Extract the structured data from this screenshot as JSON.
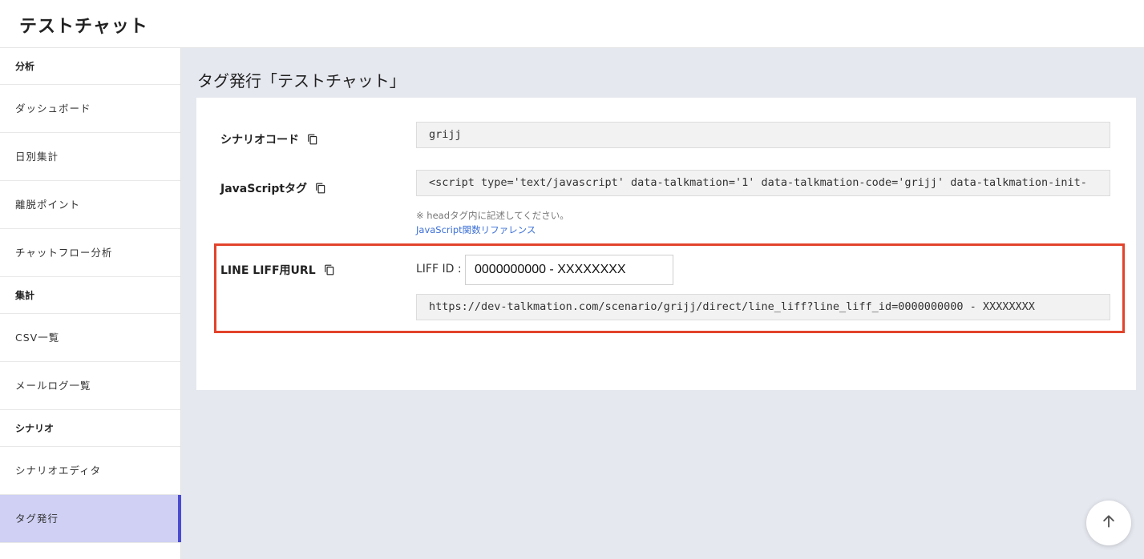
{
  "app": {
    "title": "テストチャット"
  },
  "sidebar": {
    "sections": [
      {
        "header": "分析",
        "items": [
          {
            "label": "ダッシュボード"
          },
          {
            "label": "日別集計"
          },
          {
            "label": "離脱ポイント"
          },
          {
            "label": "チャットフロー分析"
          }
        ]
      },
      {
        "header": "集計",
        "items": [
          {
            "label": "CSV一覧"
          },
          {
            "label": "メールログ一覧"
          }
        ]
      },
      {
        "header": "シナリオ",
        "items": [
          {
            "label": "シナリオエディタ"
          },
          {
            "label": "タグ発行",
            "active": true
          }
        ]
      }
    ]
  },
  "main": {
    "page_title": "タグ発行「テストチャット」",
    "scenario_code": {
      "label": "シナリオコード",
      "value": "grijj"
    },
    "js_tag": {
      "label": "JavaScriptタグ",
      "value": "<script type='text/javascript' data-talkmation='1' data-talkmation-code='grijj' data-talkmation-init-",
      "note": "※ headタグ内に記述してください。",
      "link": "JavaScript関数リファレンス"
    },
    "liff": {
      "label": "LINE LIFF用URL",
      "id_label": "LIFF ID :",
      "id_value": "0000000000 - XXXXXXXX",
      "url": "https://dev-talkmation.com/scenario/grijj/direct/line_liff?line_liff_id=0000000000 - XXXXXXXX"
    }
  },
  "icons": {
    "copy": "copy-icon",
    "scroll_top": "arrow-up-icon"
  },
  "colors": {
    "accent": "#4a4bd1",
    "active_bg": "#cfd0f4",
    "highlight": "#e2432b",
    "link": "#3b6fd6"
  }
}
